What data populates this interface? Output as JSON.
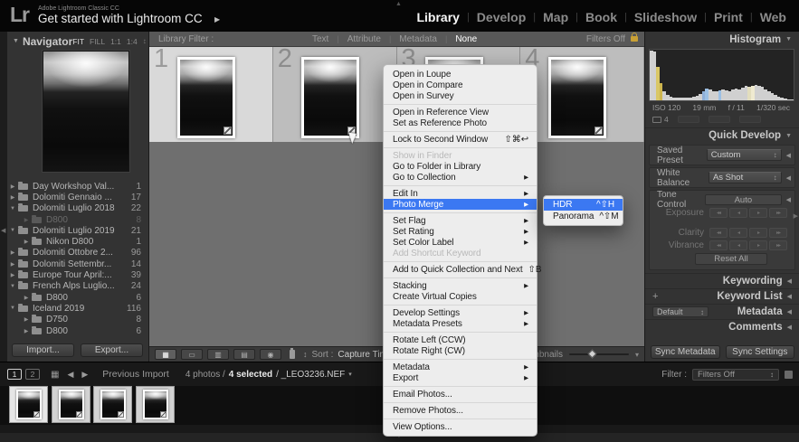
{
  "colors": {
    "accent_blue": "#3b78f2",
    "menu_bg": "#ededed",
    "panel_bg": "#333333",
    "grid_bg": "#6f6f6f",
    "lock_gold": "#c8a035"
  },
  "icons": {
    "triangle_down": "▼",
    "triangle_right": "▶",
    "triangle_left": "◀",
    "triangle_up": "▲",
    "caret_down": "▾",
    "caret_right": "▸",
    "updown": "↕",
    "plus": "+",
    "grid_view": "▦",
    "loupe_view": "▭",
    "compare_view": "▥",
    "survey_view": "▤",
    "people_view": "◉",
    "sort_direction": "↕",
    "prev_arrow": "◀",
    "next_arrow": "▶",
    "filmstrip_grid": "▦"
  },
  "top_bar": {
    "logo": "Lr",
    "plate_small": "Adobe Lightroom Classic CC",
    "plate_large": "Get started with Lightroom CC",
    "modules": [
      {
        "label": "Library",
        "active": true
      },
      {
        "label": "Develop"
      },
      {
        "label": "Map"
      },
      {
        "label": "Book"
      },
      {
        "label": "Slideshow"
      },
      {
        "label": "Print"
      },
      {
        "label": "Web"
      }
    ]
  },
  "left_panel": {
    "navigator_title": "Navigator",
    "zoom_modes": [
      {
        "label": "FIT",
        "active": true
      },
      {
        "label": "FILL"
      },
      {
        "label": "1:1"
      },
      {
        "label": "1:4"
      }
    ],
    "folders": [
      {
        "name": "Day Workshop Val...",
        "count": "1",
        "level": 0,
        "state": "collapsed"
      },
      {
        "name": "Dolomiti Gennaio ...",
        "count": "17",
        "level": 0,
        "state": "collapsed"
      },
      {
        "name": "Dolomiti Luglio 2018",
        "count": "22",
        "level": 0,
        "state": "expanded"
      },
      {
        "name": "D800",
        "count": "8",
        "level": 1,
        "state": "collapsed",
        "dimmed": true
      },
      {
        "name": "Dolomiti Luglio 2019",
        "count": "21",
        "level": 0,
        "state": "expanded"
      },
      {
        "name": "Nikon D800",
        "count": "1",
        "level": 1,
        "state": "collapsed"
      },
      {
        "name": "Dolomiti Ottobre 2...",
        "count": "96",
        "level": 0,
        "state": "collapsed"
      },
      {
        "name": "Dolomiti Settembr...",
        "count": "14",
        "level": 0,
        "state": "collapsed"
      },
      {
        "name": "Europe Tour April:...",
        "count": "39",
        "level": 0,
        "state": "collapsed"
      },
      {
        "name": "French Alps Luglio...",
        "count": "24",
        "level": 0,
        "state": "expanded"
      },
      {
        "name": "D800",
        "count": "6",
        "level": 1,
        "state": "collapsed"
      },
      {
        "name": "Iceland 2019",
        "count": "116",
        "level": 0,
        "state": "expanded"
      },
      {
        "name": "D750",
        "count": "8",
        "level": 1,
        "state": "collapsed"
      },
      {
        "name": "D800",
        "count": "6",
        "level": 1,
        "state": "collapsed"
      }
    ],
    "import_label": "Import...",
    "export_label": "Export..."
  },
  "filter_bar": {
    "label": "Library Filter :",
    "options": [
      {
        "label": "Text"
      },
      {
        "label": "Attribute"
      },
      {
        "label": "Metadata"
      },
      {
        "label": "None",
        "active": true
      }
    ],
    "filters_state": "Filters Off"
  },
  "grid": {
    "cells": [
      {
        "index": "1",
        "active": true
      },
      {
        "index": "2"
      },
      {
        "index": "3"
      },
      {
        "index": "4"
      }
    ]
  },
  "toolbar": {
    "sort_label": "Sort :",
    "sort_value": "Capture Tim",
    "thumbnails_label": "Thumbnails"
  },
  "context_menu": {
    "items": [
      {
        "label": "Open in Loupe"
      },
      {
        "label": "Open in Compare"
      },
      {
        "label": "Open in Survey"
      },
      {
        "sep": true
      },
      {
        "label": "Open in Reference View"
      },
      {
        "label": "Set as Reference Photo"
      },
      {
        "sep": true
      },
      {
        "label": "Lock to Second Window",
        "shortcut": "⇧⌘↩"
      },
      {
        "sep": true
      },
      {
        "label": "Show in Finder",
        "disabled": true
      },
      {
        "label": "Go to Folder in Library"
      },
      {
        "label": "Go to Collection",
        "arrow": true
      },
      {
        "sep": true
      },
      {
        "label": "Edit In",
        "arrow": true
      },
      {
        "label": "Photo Merge",
        "arrow": true,
        "highlighted": true
      },
      {
        "sep": true
      },
      {
        "label": "Set Flag",
        "arrow": true
      },
      {
        "label": "Set Rating",
        "arrow": true
      },
      {
        "label": "Set Color Label",
        "arrow": true
      },
      {
        "label": "Add Shortcut Keyword",
        "disabled": true
      },
      {
        "sep": true
      },
      {
        "label": "Add to Quick Collection and Next",
        "shortcut": "⇧B"
      },
      {
        "sep": true
      },
      {
        "label": "Stacking",
        "arrow": true
      },
      {
        "label": "Create Virtual Copies"
      },
      {
        "sep": true
      },
      {
        "label": "Develop Settings",
        "arrow": true
      },
      {
        "label": "Metadata Presets",
        "arrow": true
      },
      {
        "sep": true
      },
      {
        "label": "Rotate Left (CCW)"
      },
      {
        "label": "Rotate Right (CW)"
      },
      {
        "sep": true
      },
      {
        "label": "Metadata",
        "arrow": true
      },
      {
        "label": "Export",
        "arrow": true
      },
      {
        "sep": true
      },
      {
        "label": "Email Photos..."
      },
      {
        "sep": true
      },
      {
        "label": "Remove Photos..."
      },
      {
        "sep": true
      },
      {
        "label": "View Options..."
      }
    ],
    "submenu": [
      {
        "label": "HDR",
        "shortcut": "^⇧H",
        "highlighted": true
      },
      {
        "label": "Panorama",
        "shortcut": "^⇧M"
      }
    ]
  },
  "right_panel": {
    "histogram": {
      "title": "Histogram",
      "info": [
        "ISO 120",
        "19 mm",
        "f / 11",
        "1/320 sec"
      ],
      "badge_count": "4",
      "bars": [
        0.98,
        0.96,
        0.66,
        0.34,
        0.18,
        0.11,
        0.08,
        0.06,
        0.05,
        0.05,
        0.05,
        0.06,
        0.06,
        0.07,
        0.09,
        0.12,
        0.18,
        0.24,
        0.22,
        0.18,
        0.17,
        0.2,
        0.22,
        0.19,
        0.18,
        0.21,
        0.24,
        0.22,
        0.25,
        0.28,
        0.26,
        0.29,
        0.31,
        0.28,
        0.26,
        0.22,
        0.18,
        0.14,
        0.1,
        0.07,
        0.05,
        0.03,
        0.02,
        0.01
      ],
      "bar_colors": {
        "2": "#d9c765",
        "3": "#cdb54e",
        "16": "#8fb0d8",
        "17": "#9cc0e4",
        "21": "#9cc0e4",
        "30": "#e2ddbd",
        "31": "#efead0"
      }
    },
    "quick_develop": {
      "title": "Quick Develop",
      "saved_preset_label": "Saved Preset",
      "saved_preset_value": "Custom",
      "white_balance_label": "White Balance",
      "white_balance_value": "As Shot",
      "tone_control_label": "Tone Control",
      "auto_label": "Auto",
      "steppers": [
        "Exposure",
        "Clarity",
        "Vibrance"
      ],
      "reset_label": "Reset All"
    },
    "sections": {
      "keywording": "Keywording",
      "keyword_list": "Keyword List",
      "metadata": "Metadata",
      "metadata_preset": "Default",
      "comments": "Comments"
    },
    "sync_metadata": "Sync Metadata",
    "sync_settings": "Sync Settings"
  },
  "filmstrip": {
    "window_buttons": [
      "1",
      "2"
    ],
    "previous_import": "Previous Import",
    "status_photos": "4 photos /",
    "status_selected": "4 selected",
    "status_file": "/ _LEO3236.NEF",
    "filter_label": "Filter :",
    "filter_value": "Filters Off",
    "thumb_count": 4
  }
}
